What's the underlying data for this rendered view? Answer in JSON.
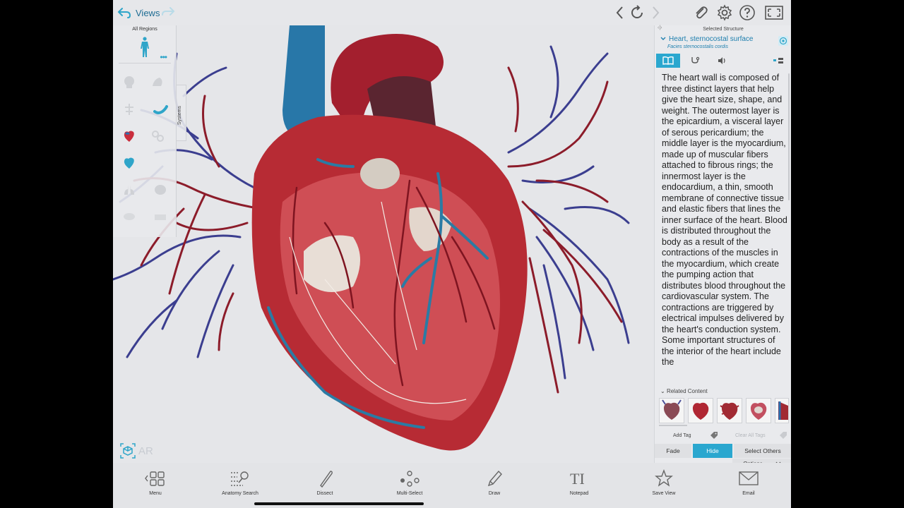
{
  "topbar": {
    "views_label": "Views",
    "icons": [
      "back-arrow-icon",
      "redo-arrow-icon",
      "chevron-left-icon",
      "reset-rotate-icon",
      "chevron-right-icon",
      "paperclip-icon",
      "gear-icon",
      "help-icon",
      "fullscreen-icon"
    ]
  },
  "regions": {
    "label": "All Regions",
    "more": "•••",
    "systems_label": "Systems"
  },
  "ar": {
    "label": "AR"
  },
  "panel": {
    "header": "Selected Structure",
    "collapse": "‹|›",
    "structure_title": "Heart, sternocostal surface",
    "structure_latin": "Facies sternocostalis cordis",
    "description": "The heart wall is composed of three distinct layers that help give the heart size, shape, and weight. The outermost layer is the epicardium, a visceral layer of serous pericardium; the middle layer is the myocardium, made up of muscular fibers attached to fibrous rings; the innermost layer is the endocardium, a thin, smooth membrane of connective tissue and elastic fibers that lines the inner surface of the heart. Blood is distributed throughout the body as a result of the contractions of the muscles in the myocardium, which create the pumping action that distributes blood throughout the cardiovascular system. The contractions are triggered by electrical impulses delivered by the heart's conduction system. Some important structures of the interior of the heart include the",
    "related_content_label": "Related Content",
    "add_tag_label": "Add Tag",
    "clear_tags_label": "Clear All Tags",
    "fade_label": "Fade",
    "hide_label": "Hide",
    "select_others_label": "Select Others",
    "options_label": "Options",
    "accent": "#2aa7cf"
  },
  "toolbar": {
    "menu": "Menu",
    "anatomy_search": "Anatomy Search",
    "dissect": "Dissect",
    "multi_select": "Multi-Select",
    "draw": "Draw",
    "notepad": "Notepad",
    "notepad_glyph": "TI",
    "save_view": "Save View",
    "email": "Email"
  }
}
